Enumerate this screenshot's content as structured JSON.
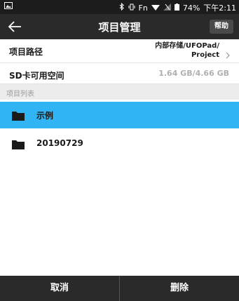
{
  "status_bar": {
    "icons": [
      "image-notification-icon",
      "bluetooth-icon",
      "vibrate-icon",
      "fn-icon",
      "wifi-icon",
      "signal-icon",
      "battery-icon"
    ],
    "fn_label": "Fn",
    "battery": "74%",
    "time": "下午2:11"
  },
  "app_bar": {
    "title": "项目管理",
    "help_label": "帮助",
    "back_icon": "arrow-left-icon"
  },
  "settings": {
    "path_label": "项目路径",
    "path_value_line1": "内部存储/UFOPad/",
    "path_value_line2": "Project",
    "sd_label": "SD卡可用空间",
    "sd_value": "1.64 GB/4.66 GB"
  },
  "list": {
    "header": "项目列表",
    "items": [
      {
        "name": "示例",
        "selected": true
      },
      {
        "name": "20190729",
        "selected": false
      }
    ]
  },
  "bottom_bar": {
    "cancel_label": "取消",
    "delete_label": "删除"
  },
  "colors": {
    "selected": "#30b4f4",
    "bar": "#2a2a2a"
  }
}
